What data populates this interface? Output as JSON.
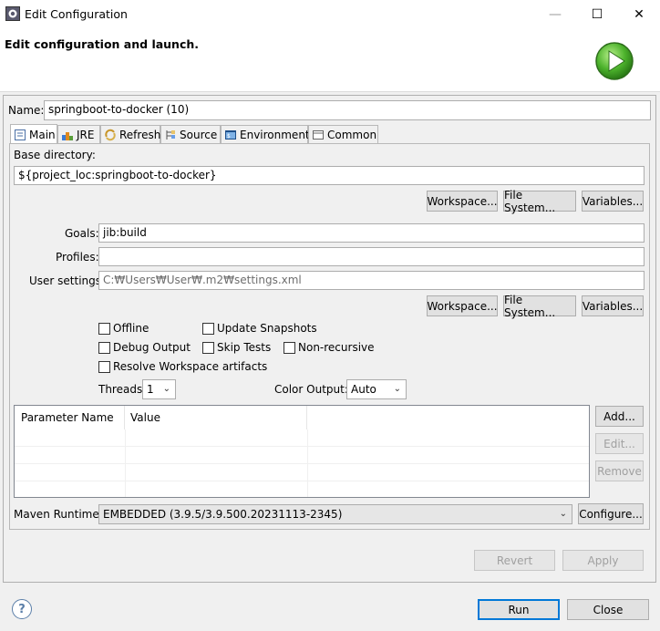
{
  "window": {
    "title": "Edit Configuration",
    "minimize_glyph": "—",
    "maximize_glyph": "☐",
    "close_glyph": "✕"
  },
  "header": {
    "title": "Edit configuration and launch.",
    "icon": "run-icon"
  },
  "name": {
    "label": "Name:",
    "value": "springboot-to-docker (10)"
  },
  "tabs": [
    {
      "label": "Main",
      "icon": "main-tab-icon",
      "active": true
    },
    {
      "label": "JRE",
      "icon": "jre-icon"
    },
    {
      "label": "Refresh",
      "icon": "refresh-icon"
    },
    {
      "label": "Source",
      "icon": "source-icon"
    },
    {
      "label": "Environment",
      "icon": "environment-icon"
    },
    {
      "label": "Common",
      "icon": "common-icon"
    }
  ],
  "main": {
    "base_dir_label": "Base directory:",
    "base_dir_value": "${project_loc:springboot-to-docker}",
    "buttons_row1": {
      "workspace": "Workspace...",
      "filesystem": "File System...",
      "variables": "Variables..."
    },
    "goals_label": "Goals:",
    "goals_value": "jib:build",
    "profiles_label": "Profiles:",
    "profiles_value": "",
    "user_settings_label": "User settings:",
    "user_settings_value": "C:₩Users₩User₩.m2₩settings.xml",
    "buttons_row2": {
      "workspace": "Workspace...",
      "filesystem": "File System...",
      "variables": "Variables..."
    },
    "checkboxes": {
      "offline": "Offline",
      "update_snapshots": "Update Snapshots",
      "debug_output": "Debug Output",
      "skip_tests": "Skip Tests",
      "non_recursive": "Non-recursive",
      "resolve_workspace": "Resolve Workspace artifacts"
    },
    "threads_label": "Threads:",
    "threads_value": "1",
    "color_output_label": "Color Output:",
    "color_output_value": "Auto",
    "params_table": {
      "columns": [
        "Parameter Name",
        "Value"
      ],
      "rows": []
    },
    "param_buttons": {
      "add": "Add...",
      "edit": "Edit...",
      "remove": "Remove"
    },
    "runtime_label": "Maven Runtime:",
    "runtime_value": "EMBEDDED (3.9.5/3.9.500.20231113-2345)",
    "configure_label": "Configure..."
  },
  "footer": {
    "revert": "Revert",
    "apply": "Apply",
    "run": "Run",
    "close": "Close",
    "help_glyph": "?"
  }
}
